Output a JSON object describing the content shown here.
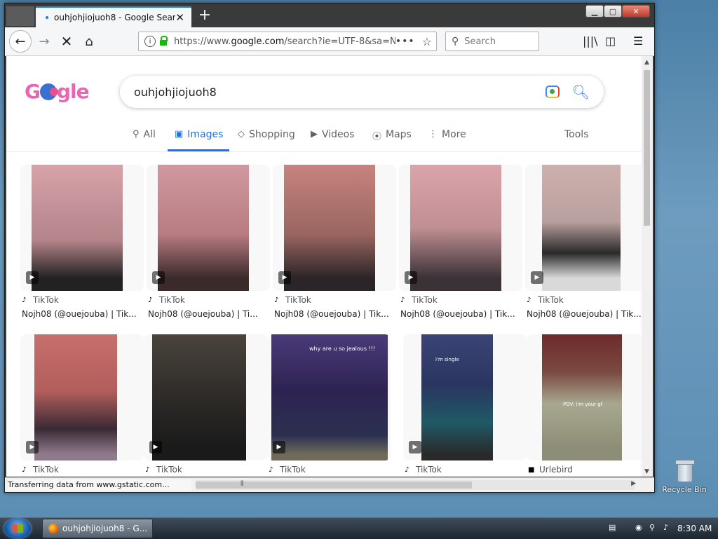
{
  "browser": {
    "tab_title": "ouhjohjiojuoh8 - Google Search",
    "new_tab": "+",
    "url_grey": "https://www.",
    "url_domain": "google.com",
    "url_rest": "/search?ie=UTF-8&sa=N",
    "search_placeholder": "Search",
    "status_text": "Transferring data from www.gstatic.com..."
  },
  "google": {
    "logo_left": "G",
    "logo_right": "gle",
    "query": "ouhjohjiojuoh8",
    "tabs": [
      {
        "label": "All",
        "icon": "🔍"
      },
      {
        "label": "Images",
        "icon": "🖼"
      },
      {
        "label": "Shopping",
        "icon": "◇"
      },
      {
        "label": "Videos",
        "icon": "▶"
      },
      {
        "label": "Maps",
        "icon": "📍"
      },
      {
        "label": "More",
        "icon": "⋮"
      }
    ],
    "tools": "Tools"
  },
  "results": [
    {
      "source": "TikTok",
      "caption": "Nojh08 (@ouejouba) | Tik...",
      "color": "#d39aa1"
    },
    {
      "source": "TikTok",
      "caption": "Nojh08 (@ouejouba) | Ti...",
      "color": "#c98f95"
    },
    {
      "source": "TikTok",
      "caption": "Nojh08 (@ouejouba) | Tik...",
      "color": "#b7736f"
    },
    {
      "source": "TikTok",
      "caption": "Nojh08 (@ouejouba) | Tik...",
      "color": "#d19aa2"
    },
    {
      "source": "TikTok",
      "caption": "Nojh08 (@ouejouba) | Tik...",
      "color": "#c7a9a8"
    },
    {
      "source": "TikTok",
      "caption": "",
      "color": "#c56e6c"
    },
    {
      "source": "TikTok",
      "caption": "",
      "color": "#3a3632"
    },
    {
      "source": "TikTok",
      "caption": "",
      "color": "#3b2e56",
      "overlay": "why are u so jealous !!!"
    },
    {
      "source": "TikTok",
      "caption": "",
      "color": "#2e3b55",
      "overlay": "i'm single"
    },
    {
      "source": "Urlebird",
      "caption": "",
      "color": "#6d5c4e",
      "overlay": "POV: i'm your gf"
    }
  ],
  "desktop": {
    "recycle_bin": "Recycle Bin"
  },
  "taskbar": {
    "task_label": "ouhjohjiojuoh8 - G...",
    "clock": "8:30 AM"
  }
}
